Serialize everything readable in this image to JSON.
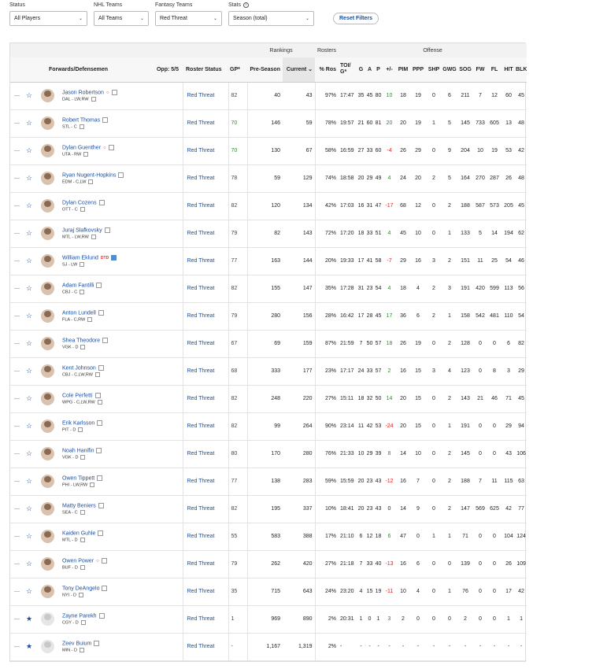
{
  "filters": {
    "status": {
      "label": "Status",
      "value": "All Players"
    },
    "nhl": {
      "label": "NHL Teams",
      "value": "All Teams"
    },
    "fantasy": {
      "label": "Fantasy Teams",
      "value": "Red Threat"
    },
    "stats": {
      "label": "Stats",
      "value": "Season (total)"
    },
    "reset": "Reset Filters"
  },
  "groups": {
    "rankings": "Rankings",
    "rosters": "Rosters",
    "offense": "Offense"
  },
  "headers": {
    "player": "Forwards/Defensemen",
    "opp": "Opp: 5/5",
    "roster": "Roster Status",
    "gp": "GP*",
    "pre": "Pre-Season",
    "cur": "Current",
    "ros": "% Ros",
    "toi": "TOI/ G*",
    "g": "G",
    "a": "A",
    "p": "P",
    "pm": "+/-",
    "pim": "PIM",
    "ppp": "PPP",
    "shp": "SHP",
    "gwg": "GWG",
    "sog": "SOG",
    "fw": "FW",
    "fl": "FL",
    "hit": "HIT",
    "blk": "BLK"
  },
  "players": [
    {
      "name": "Jason Robertson",
      "meta": "DAL - LW,RW",
      "flag": "dot",
      "roster": "Red Threat",
      "gp": "82",
      "pre": "40",
      "cur": "43",
      "ros": "97%",
      "toi": "17:47",
      "g": "35",
      "a": "45",
      "p": "80",
      "pm": "10",
      "pim": "18",
      "ppp": "19",
      "shp": "0",
      "gwg": "6",
      "sog": "211",
      "fw": "7",
      "fl": "12",
      "hit": "60",
      "blk": "45"
    },
    {
      "name": "Robert Thomas",
      "meta": "STL - C",
      "flag": "",
      "roster": "Red Threat",
      "gp": "70",
      "pre": "146",
      "cur": "59",
      "ros": "78%",
      "toi": "19:57",
      "g": "21",
      "a": "60",
      "p": "81",
      "pm": "20",
      "pim": "20",
      "ppp": "19",
      "shp": "1",
      "gwg": "5",
      "sog": "145",
      "fw": "733",
      "fl": "605",
      "hit": "13",
      "blk": "48"
    },
    {
      "name": "Dylan Guenther",
      "meta": "UTA - RW",
      "flag": "dot",
      "roster": "Red Threat",
      "gp": "70",
      "pre": "130",
      "cur": "67",
      "ros": "58%",
      "toi": "16:59",
      "g": "27",
      "a": "33",
      "p": "60",
      "pm": "-4",
      "pim": "26",
      "ppp": "29",
      "shp": "0",
      "gwg": "9",
      "sog": "204",
      "fw": "10",
      "fl": "19",
      "hit": "53",
      "blk": "42"
    },
    {
      "name": "Ryan Nugent-Hopkins",
      "meta": "EDM - C,LW",
      "flag": "",
      "roster": "Red Threat",
      "gp": "78",
      "pre": "59",
      "cur": "129",
      "ros": "74%",
      "toi": "18:58",
      "g": "20",
      "a": "29",
      "p": "49",
      "pm": "4",
      "pim": "24",
      "ppp": "20",
      "shp": "2",
      "gwg": "5",
      "sog": "164",
      "fw": "270",
      "fl": "287",
      "hit": "26",
      "blk": "48"
    },
    {
      "name": "Dylan Cozens",
      "meta": "OTT - C",
      "flag": "",
      "roster": "Red Threat",
      "gp": "82",
      "pre": "120",
      "cur": "134",
      "ros": "42%",
      "toi": "17:03",
      "g": "16",
      "a": "31",
      "p": "47",
      "pm": "-17",
      "pim": "68",
      "ppp": "12",
      "shp": "0",
      "gwg": "2",
      "sog": "188",
      "fw": "587",
      "fl": "573",
      "hit": "205",
      "blk": "45"
    },
    {
      "name": "Juraj Slafkovsky",
      "meta": "MTL - LW,RW",
      "flag": "",
      "roster": "Red Threat",
      "gp": "79",
      "pre": "82",
      "cur": "143",
      "ros": "72%",
      "toi": "17:20",
      "g": "18",
      "a": "33",
      "p": "51",
      "pm": "4",
      "pim": "45",
      "ppp": "10",
      "shp": "0",
      "gwg": "1",
      "sog": "133",
      "fw": "5",
      "fl": "14",
      "hit": "194",
      "blk": "62"
    },
    {
      "name": "William Eklund",
      "meta": "SJ - LW",
      "flag": "dtd",
      "roster": "Red Threat",
      "gp": "77",
      "pre": "163",
      "cur": "144",
      "ros": "20%",
      "toi": "19:33",
      "g": "17",
      "a": "41",
      "p": "58",
      "pm": "-7",
      "pim": "29",
      "ppp": "16",
      "shp": "3",
      "gwg": "2",
      "sog": "151",
      "fw": "11",
      "fl": "25",
      "hit": "54",
      "blk": "46"
    },
    {
      "name": "Adam Fantilli",
      "meta": "CBJ - C",
      "flag": "",
      "roster": "Red Threat",
      "gp": "82",
      "pre": "155",
      "cur": "147",
      "ros": "35%",
      "toi": "17:28",
      "g": "31",
      "a": "23",
      "p": "54",
      "pm": "4",
      "pim": "18",
      "ppp": "4",
      "shp": "2",
      "gwg": "3",
      "sog": "191",
      "fw": "420",
      "fl": "599",
      "hit": "113",
      "blk": "56"
    },
    {
      "name": "Anton Lundell",
      "meta": "FLA - C,RW",
      "flag": "",
      "roster": "Red Threat",
      "gp": "79",
      "pre": "280",
      "cur": "156",
      "ros": "28%",
      "toi": "16:42",
      "g": "17",
      "a": "28",
      "p": "45",
      "pm": "17",
      "pim": "36",
      "ppp": "6",
      "shp": "2",
      "gwg": "1",
      "sog": "158",
      "fw": "542",
      "fl": "481",
      "hit": "110",
      "blk": "54"
    },
    {
      "name": "Shea Theodore",
      "meta": "VGK - D",
      "flag": "",
      "roster": "Red Threat",
      "gp": "67",
      "pre": "69",
      "cur": "159",
      "ros": "87%",
      "toi": "21:59",
      "g": "7",
      "a": "50",
      "p": "57",
      "pm": "18",
      "pim": "26",
      "ppp": "19",
      "shp": "0",
      "gwg": "2",
      "sog": "128",
      "fw": "0",
      "fl": "0",
      "hit": "6",
      "blk": "82"
    },
    {
      "name": "Kent Johnson",
      "meta": "CBJ - C,LW,RW",
      "flag": "",
      "roster": "Red Threat",
      "gp": "68",
      "pre": "333",
      "cur": "177",
      "ros": "23%",
      "toi": "17:17",
      "g": "24",
      "a": "33",
      "p": "57",
      "pm": "2",
      "pim": "16",
      "ppp": "15",
      "shp": "3",
      "gwg": "4",
      "sog": "123",
      "fw": "0",
      "fl": "8",
      "hit": "3",
      "blk": "29"
    },
    {
      "name": "Cole Perfetti",
      "meta": "WPG - C,LW,RW",
      "flag": "",
      "roster": "Red Threat",
      "gp": "82",
      "pre": "248",
      "cur": "220",
      "ros": "27%",
      "toi": "15:11",
      "g": "18",
      "a": "32",
      "p": "50",
      "pm": "14",
      "pim": "20",
      "ppp": "15",
      "shp": "0",
      "gwg": "2",
      "sog": "143",
      "fw": "21",
      "fl": "46",
      "hit": "71",
      "blk": "45"
    },
    {
      "name": "Erik Karlsson",
      "meta": "PIT - D",
      "flag": "",
      "roster": "Red Threat",
      "gp": "82",
      "pre": "99",
      "cur": "264",
      "ros": "90%",
      "toi": "23:14",
      "g": "11",
      "a": "42",
      "p": "53",
      "pm": "-24",
      "pim": "20",
      "ppp": "15",
      "shp": "0",
      "gwg": "1",
      "sog": "191",
      "fw": "0",
      "fl": "0",
      "hit": "29",
      "blk": "94"
    },
    {
      "name": "Noah Hanifin",
      "meta": "VGK - D",
      "flag": "",
      "roster": "Red Threat",
      "gp": "80",
      "pre": "170",
      "cur": "280",
      "ros": "76%",
      "toi": "21:33",
      "g": "10",
      "a": "29",
      "p": "39",
      "pm": "8",
      "pim": "14",
      "ppp": "10",
      "shp": "0",
      "gwg": "2",
      "sog": "145",
      "fw": "0",
      "fl": "0",
      "hit": "43",
      "blk": "106"
    },
    {
      "name": "Owen Tippett",
      "meta": "PHI - LW,RW",
      "flag": "",
      "roster": "Red Threat",
      "gp": "77",
      "pre": "138",
      "cur": "283",
      "ros": "59%",
      "toi": "15:59",
      "g": "20",
      "a": "23",
      "p": "43",
      "pm": "-12",
      "pim": "16",
      "ppp": "7",
      "shp": "0",
      "gwg": "2",
      "sog": "188",
      "fw": "7",
      "fl": "11",
      "hit": "115",
      "blk": "63"
    },
    {
      "name": "Matty Beniers",
      "meta": "SEA - C",
      "flag": "",
      "roster": "Red Threat",
      "gp": "82",
      "pre": "195",
      "cur": "337",
      "ros": "10%",
      "toi": "18:41",
      "g": "20",
      "a": "23",
      "p": "43",
      "pm": "0",
      "pim": "14",
      "ppp": "9",
      "shp": "0",
      "gwg": "2",
      "sog": "147",
      "fw": "569",
      "fl": "625",
      "hit": "42",
      "blk": "77"
    },
    {
      "name": "Kaiden Guhle",
      "meta": "MTL - D",
      "flag": "",
      "roster": "Red Threat",
      "gp": "55",
      "pre": "583",
      "cur": "388",
      "ros": "17%",
      "toi": "21:10",
      "g": "6",
      "a": "12",
      "p": "18",
      "pm": "6",
      "pim": "47",
      "ppp": "0",
      "shp": "1",
      "gwg": "1",
      "sog": "71",
      "fw": "0",
      "fl": "0",
      "hit": "104",
      "blk": "124"
    },
    {
      "name": "Owen Power",
      "meta": "BUF - D",
      "flag": "dot",
      "roster": "Red Threat",
      "gp": "79",
      "pre": "262",
      "cur": "420",
      "ros": "27%",
      "toi": "21:18",
      "g": "7",
      "a": "33",
      "p": "40",
      "pm": "-13",
      "pim": "16",
      "ppp": "6",
      "shp": "0",
      "gwg": "0",
      "sog": "139",
      "fw": "0",
      "fl": "0",
      "hit": "26",
      "blk": "109"
    },
    {
      "name": "Tony DeAngelo",
      "meta": "NYI - D",
      "flag": "",
      "roster": "Red Threat",
      "gp": "35",
      "pre": "715",
      "cur": "643",
      "ros": "24%",
      "toi": "23:20",
      "g": "4",
      "a": "15",
      "p": "19",
      "pm": "-11",
      "pim": "10",
      "ppp": "4",
      "shp": "0",
      "gwg": "1",
      "sog": "76",
      "fw": "0",
      "fl": "0",
      "hit": "17",
      "blk": "42"
    },
    {
      "name": "Zayne Parekh",
      "meta": "CGY - D",
      "flag": "",
      "roster": "Red Threat",
      "gp": "1",
      "pre": "969",
      "cur": "890",
      "ros": "2%",
      "toi": "20:31",
      "g": "1",
      "a": "0",
      "p": "1",
      "pm": "3",
      "pim": "2",
      "ppp": "0",
      "shp": "0",
      "gwg": "0",
      "sog": "2",
      "fw": "0",
      "fl": "0",
      "hit": "1",
      "blk": "1"
    },
    {
      "name": "Zeev Buium",
      "meta": "MIN - D",
      "flag": "",
      "roster": "Red Threat",
      "gp": "-",
      "pre": "1,167",
      "cur": "1,319",
      "ros": "2%",
      "toi": "-",
      "g": "-",
      "a": "-",
      "p": "-",
      "pm": "-",
      "pim": "-",
      "ppp": "-",
      "shp": "-",
      "gwg": "-",
      "sog": "-",
      "fw": "-",
      "fl": "-",
      "hit": "-",
      "blk": "-"
    }
  ]
}
